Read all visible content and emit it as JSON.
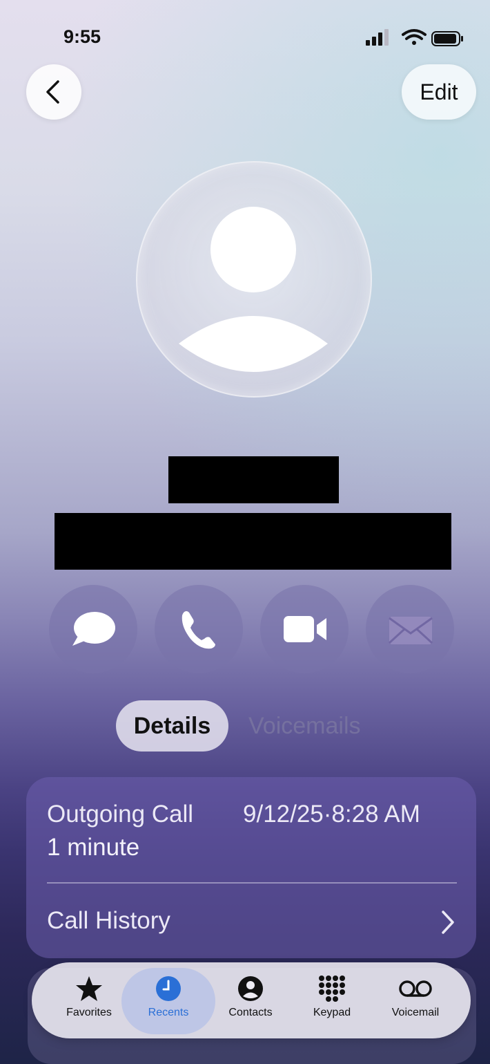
{
  "status_bar": {
    "time": "9:55"
  },
  "nav": {
    "back_icon": "chevron-left-icon",
    "edit_label": "Edit"
  },
  "contact": {
    "avatar_icon": "person-icon"
  },
  "actions": [
    {
      "name": "message",
      "icon": "message-bubble-icon"
    },
    {
      "name": "call",
      "icon": "phone-icon"
    },
    {
      "name": "video",
      "icon": "video-camera-icon"
    },
    {
      "name": "mail",
      "icon": "envelope-icon"
    }
  ],
  "segments": {
    "details": "Details",
    "voicemails": "Voicemails",
    "selected": "Details"
  },
  "call_details": {
    "type": "Outgoing Call",
    "datetime": "9/12/25·8:28 AM",
    "duration": "1 minute",
    "history_label": "Call History"
  },
  "tabbar": {
    "active": "Recents",
    "active_color": "#2a6fd6",
    "items": [
      {
        "label": "Favorites",
        "icon": "star-icon"
      },
      {
        "label": "Recents",
        "icon": "clock-icon"
      },
      {
        "label": "Contacts",
        "icon": "person-circle-icon"
      },
      {
        "label": "Keypad",
        "icon": "keypad-grid-icon"
      },
      {
        "label": "Voicemail",
        "icon": "voicemail-icon"
      }
    ]
  }
}
